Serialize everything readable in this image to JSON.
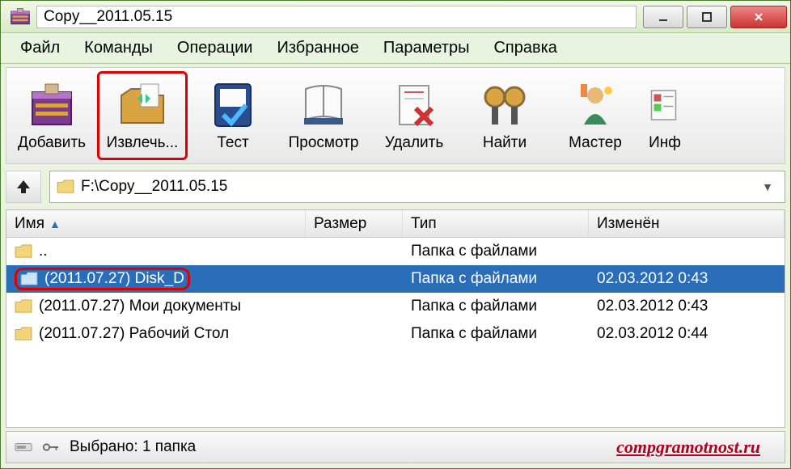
{
  "window": {
    "title": "Copy__2011.05.15"
  },
  "menu": {
    "file": "Файл",
    "commands": "Команды",
    "operations": "Операции",
    "favorites": "Избранное",
    "params": "Параметры",
    "help": "Справка"
  },
  "toolbar": {
    "add": "Добавить",
    "extract": "Извлечь...",
    "test": "Тест",
    "view": "Просмотр",
    "delete": "Удалить",
    "find": "Найти",
    "wizard": "Мастер",
    "info": "Инф"
  },
  "address": {
    "path": "F:\\Copy__2011.05.15"
  },
  "columns": {
    "name": "Имя",
    "size": "Размер",
    "type": "Тип",
    "modified": "Изменён"
  },
  "rows": {
    "up": {
      "name": "..",
      "type": "Папка с файлами",
      "modified": ""
    },
    "r1": {
      "name": "(2011.07.27) Disk_D",
      "type": "Папка с файлами",
      "modified": "02.03.2012 0:43"
    },
    "r2": {
      "name": "(2011.07.27) Мои документы",
      "type": "Папка с файлами",
      "modified": "02.03.2012 0:43"
    },
    "r3": {
      "name": "(2011.07.27) Рабочий Стол",
      "type": "Папка с файлами",
      "modified": "02.03.2012 0:44"
    }
  },
  "status": {
    "text": "Выбрано: 1 папка"
  },
  "watermark": "compgramotnost.ru"
}
